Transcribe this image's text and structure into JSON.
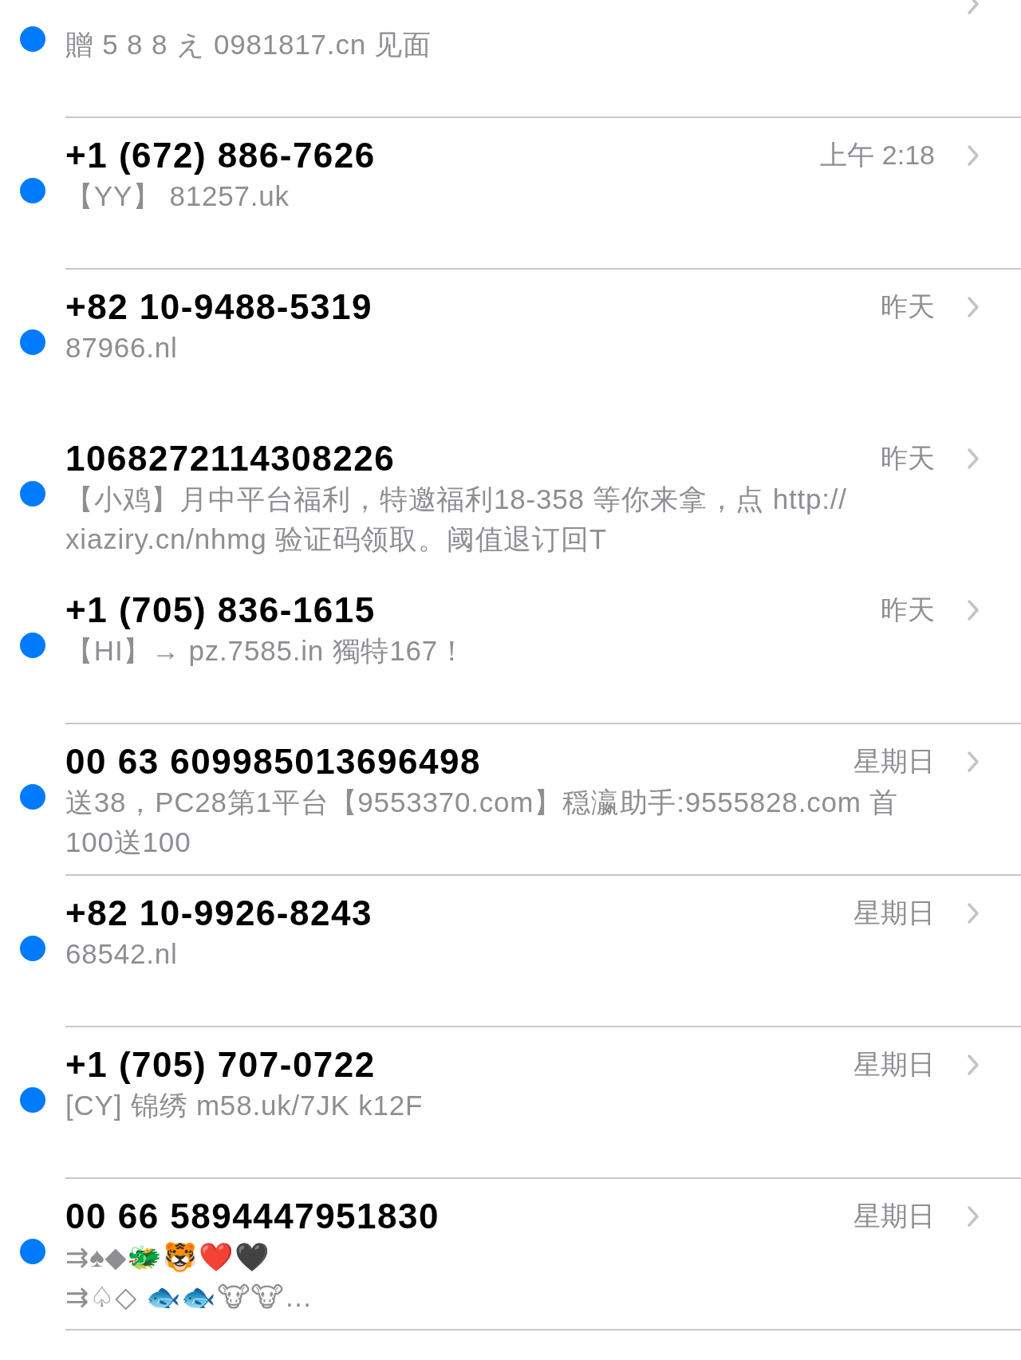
{
  "messages": [
    {
      "preview": "贈 5 8 8 え  0981817.cn  见面",
      "unread": true,
      "separator": true
    },
    {
      "sender": "+1 (672) 886-7626",
      "time": "上午 2:18",
      "preview": "【YY】 81257.uk",
      "unread": true,
      "separator": true
    },
    {
      "sender": "+82 10-9488-5319",
      "time": "昨天",
      "preview": "87966.nl",
      "unread": true,
      "separator": false
    },
    {
      "sender": "1068272114308226",
      "time": "昨天",
      "preview": "【小鸡】月中平台福利，特邀福利18-358 等你来拿，点 http://\nxiaziry.cn/nhmg 验证码领取。阈值退订回T",
      "unread": true,
      "separator": false
    },
    {
      "sender": "+1 (705) 836-1615",
      "time": "昨天",
      "preview": "【HI】→ pz.7585.in  獨特167！",
      "unread": true,
      "separator": true
    },
    {
      "sender": "00 63 609985013696498",
      "time": "星期日",
      "preview": "送38，PC28第1平台【9553370.com】穏瀛助手:9555828.com 首\n100送100",
      "unread": true,
      "separator": true
    },
    {
      "sender": "+82 10-9926-8243",
      "time": "星期日",
      "preview": "68542.nl",
      "unread": true,
      "separator": true
    },
    {
      "sender": "+1 (705) 707-0722",
      "time": "星期日",
      "preview": "[CY] 锦绣  m58.uk/7JK  k12F",
      "unread": true,
      "separator": true
    },
    {
      "sender": "00 66 5894447951830",
      "time": "星期日",
      "preview": "⇉♠◆🐲🐯❤️🖤\n⇉♤◇ 🐟🐟🐮🐮…",
      "unread": true,
      "separator": true
    }
  ]
}
